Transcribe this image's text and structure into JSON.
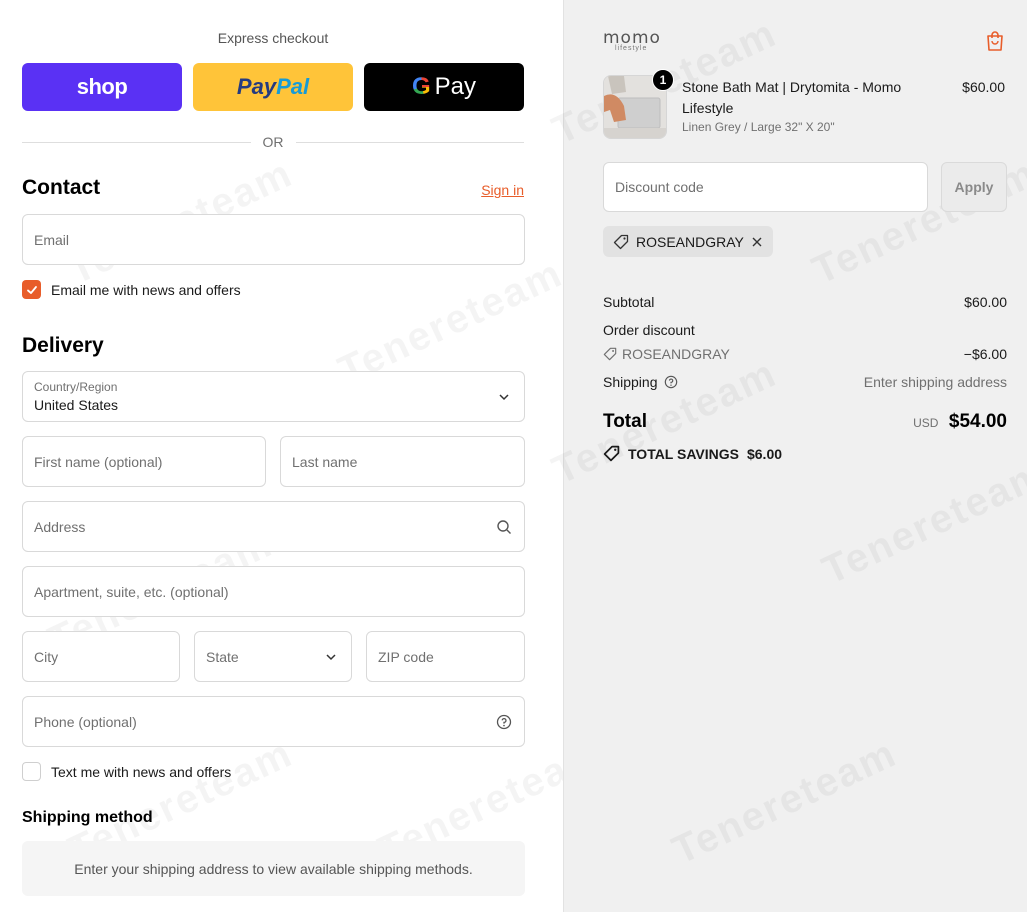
{
  "express": {
    "title": "Express checkout",
    "shop_label": "shop",
    "paypal_part1": "Pay",
    "paypal_part2": "Pal",
    "gpay_g": "G",
    "gpay_label": "Pay",
    "or_label": "OR"
  },
  "contact": {
    "heading": "Contact",
    "signin_label": "Sign in",
    "email_placeholder": "Email",
    "news_label": "Email me with news and offers",
    "news_checked": true
  },
  "delivery": {
    "heading": "Delivery",
    "country_label": "Country/Region",
    "country_value": "United States",
    "first_name_placeholder": "First name (optional)",
    "last_name_placeholder": "Last name",
    "address_placeholder": "Address",
    "apartment_placeholder": "Apartment, suite, etc. (optional)",
    "city_placeholder": "City",
    "state_placeholder": "State",
    "zip_placeholder": "ZIP code",
    "phone_placeholder": "Phone (optional)",
    "text_label": "Text me with news and offers",
    "text_checked": false
  },
  "shipping_method": {
    "heading": "Shipping method",
    "message": "Enter your shipping address to view available shipping methods."
  },
  "watermark": "Tenereteam",
  "summary": {
    "logo_main": "momo",
    "logo_sub": "lifestyle",
    "product": {
      "quantity": "1",
      "name": "Stone Bath Mat | Drytomita - Momo Lifestyle",
      "variant": "Linen Grey / Large 32\" X 20\"",
      "price": "$60.00"
    },
    "discount_placeholder": "Discount code",
    "apply_label": "Apply",
    "applied_code": "ROSEANDGRAY",
    "subtotal_label": "Subtotal",
    "subtotal_value": "$60.00",
    "order_discount_label": "Order discount",
    "discount_code": "ROSEANDGRAY",
    "discount_value": "−$6.00",
    "shipping_label": "Shipping",
    "shipping_value": "Enter shipping address",
    "total_label": "Total",
    "currency": "USD",
    "total_value": "$54.00",
    "savings_label": "TOTAL SAVINGS",
    "savings_value": "$6.00"
  },
  "colors": {
    "accent": "#e85d2a",
    "shop_purple": "#5a31f4",
    "paypal_yellow": "#ffc439"
  }
}
